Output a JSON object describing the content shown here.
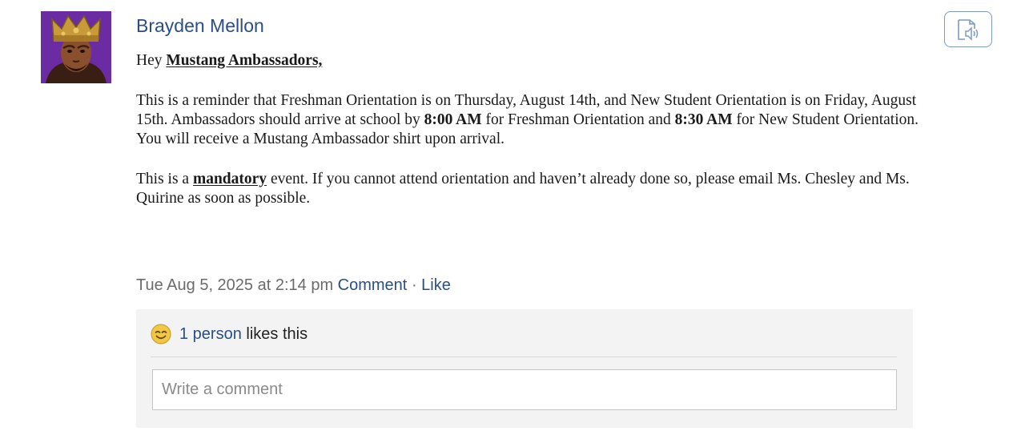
{
  "post": {
    "author": "Brayden Mellon",
    "greeting_prefix": "Hey ",
    "greeting_group": "Mustang Ambassadors,",
    "para1_a": "This is a reminder that Freshman Orientation is on Thursday, August 14th, and New Student Orientation is on Friday, August 15th. Ambassadors should arrive at school by ",
    "para1_time1": "8:00 AM",
    "para1_b": " for Freshman Orientation and ",
    "para1_time2": "8:30 AM",
    "para1_c": " for New Student Orientation. You will receive a Mustang Ambassador shirt upon arrival.",
    "para2_a": "This is a ",
    "para2_emph": "mandatory",
    "para2_b": " event. If you cannot attend orientation and haven’t already done so, please email Ms. Chesley and Ms. Quirine as soon as possible.",
    "timestamp": "Tue Aug 5, 2025 at 2:14 pm",
    "comment_label": "Comment",
    "separator": "·",
    "like_label": "Like"
  },
  "likes": {
    "count_text": "1 person",
    "suffix": " likes this"
  },
  "comment": {
    "placeholder": "Write a comment",
    "value": ""
  },
  "icons": {
    "avatar": "crowned-person-avatar",
    "read_aloud": "read-aloud-icon",
    "reaction": "smiley-emoji-icon"
  },
  "colors": {
    "link": "#2a4f86",
    "meta": "#6b6b6b",
    "panel": "#f3f3f3",
    "avatar_bg": "#6a2ba3"
  }
}
